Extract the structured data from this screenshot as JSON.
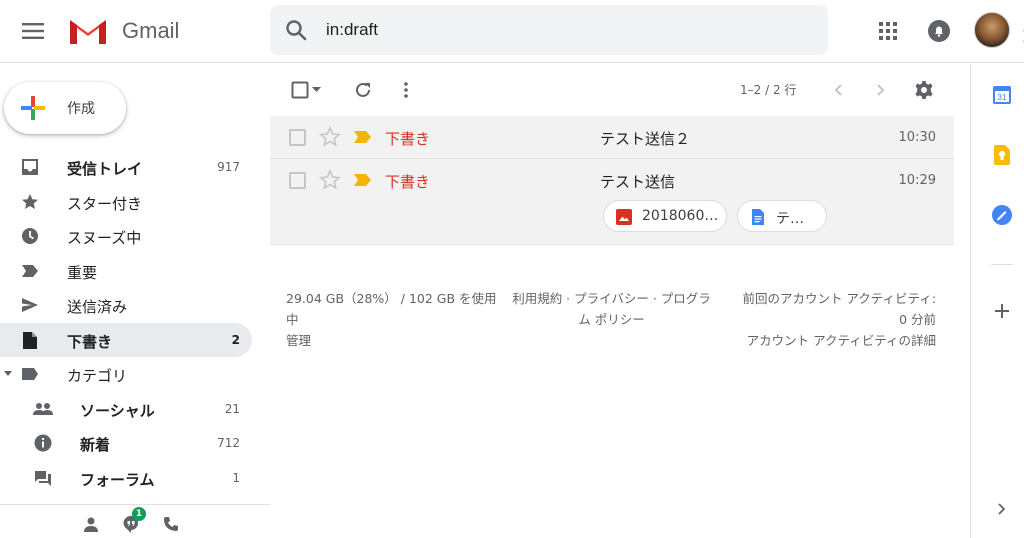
{
  "header": {
    "app_name": "Gmail",
    "search_value": "in:draft",
    "icons": [
      "menu-icon",
      "gmail-logo",
      "search-icon",
      "close-icon",
      "dropdown-arrow-icon",
      "apps-grid-icon",
      "notifications-icon",
      "avatar"
    ]
  },
  "compose": {
    "label": "作成"
  },
  "nav": {
    "items": [
      {
        "id": "inbox",
        "label": "受信トレイ",
        "count": "917",
        "icon": "inbox-icon",
        "bold": true
      },
      {
        "id": "starred",
        "label": "スター付き",
        "count": "",
        "icon": "star-icon"
      },
      {
        "id": "snoozed",
        "label": "スヌーズ中",
        "count": "",
        "icon": "clock-icon"
      },
      {
        "id": "important",
        "label": "重要",
        "count": "",
        "icon": "important-icon"
      },
      {
        "id": "sent",
        "label": "送信済み",
        "count": "",
        "icon": "send-icon"
      },
      {
        "id": "drafts",
        "label": "下書き",
        "count": "2",
        "icon": "draft-icon",
        "bold": true,
        "active": true
      },
      {
        "id": "categories",
        "label": "カテゴリ",
        "count": "",
        "icon": "label-icon"
      }
    ],
    "sub_items": [
      {
        "id": "social",
        "label": "ソーシャル",
        "count": "21",
        "icon": "people-icon"
      },
      {
        "id": "updates",
        "label": "新着",
        "count": "712",
        "icon": "info-icon"
      },
      {
        "id": "forums",
        "label": "フォーラム",
        "count": "1",
        "icon": "forum-icon"
      }
    ]
  },
  "bottom_bar": {
    "hangouts_badge": "1"
  },
  "toolbar": {
    "pager": "1–2 / 2 行"
  },
  "emails": [
    {
      "sender": "下書き",
      "subject": "テスト送信２",
      "time": "10:30"
    },
    {
      "sender": "下書き",
      "subject": "テスト送信",
      "time": "10:29",
      "attachments": [
        {
          "label": "2018060…",
          "icon": "image-file-icon"
        },
        {
          "label": "テ…",
          "icon": "doc-file-icon"
        }
      ]
    }
  ],
  "footer": {
    "storage_line1": "29.04 GB（28%） / 102 GB を使用",
    "storage_line2": "中",
    "manage": "管理",
    "links_line1": "利用規約 · プライバシー · プログラ",
    "links_line2": "ム ポリシー",
    "activity_line1": "前回のアカウント アクティビティ:",
    "activity_line2": "0 分前",
    "activity_details": "アカウント アクティビティの詳細"
  },
  "colors": {
    "gmail_red": "#d93025",
    "important_yellow": "#f4b400",
    "active_nav_bg": "#e8eaed",
    "row_bg": "#f2f2f2"
  }
}
